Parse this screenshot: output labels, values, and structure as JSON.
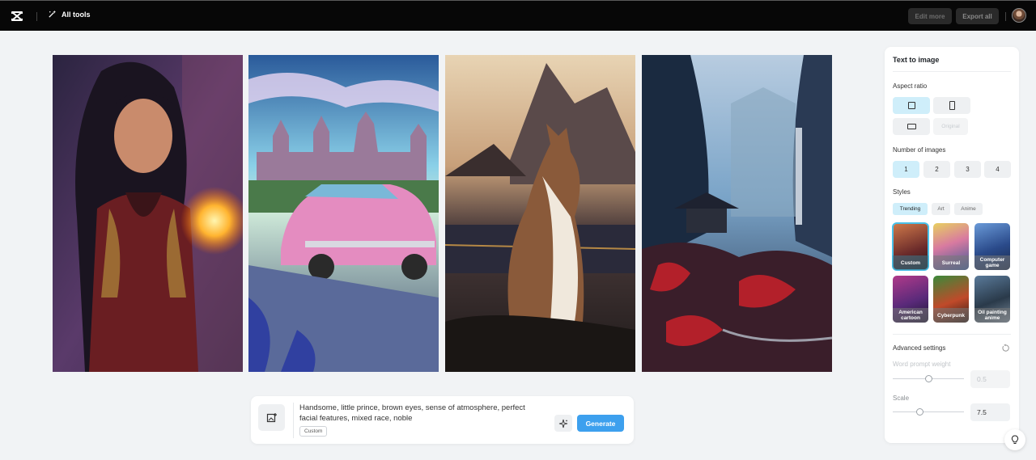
{
  "topbar": {
    "all_tools_label": "All tools",
    "edit_more_label": "Edit more",
    "export_all_label": "Export all"
  },
  "gallery": {
    "images": [
      {
        "subject": "warrior-woman",
        "palette": [
          "#3e2a55",
          "#7a2a30"
        ]
      },
      {
        "subject": "pink-car-castle",
        "palette": [
          "#5fb0d8",
          "#e58fc4"
        ]
      },
      {
        "subject": "cat-mountains",
        "palette": [
          "#d8b48a",
          "#3a2e2a"
        ]
      },
      {
        "subject": "valley-pagoda",
        "palette": [
          "#7aa4c8",
          "#b3202a"
        ]
      }
    ]
  },
  "prompt": {
    "text": "Handsome, little prince, brown eyes, sense of atmosphere, perfect facial features, mixed race, noble",
    "style_tag": "Custom",
    "generate_label": "Generate"
  },
  "panel": {
    "title": "Text to image",
    "aspect_ratio_label": "Aspect ratio",
    "aspect_original_label": "Original",
    "number_of_images_label": "Number of images",
    "number_options": [
      "1",
      "2",
      "3",
      "4"
    ],
    "number_selected": "1",
    "styles_label": "Styles",
    "style_tabs": [
      "Trending",
      "Art",
      "Anime"
    ],
    "style_cards": [
      "Custom",
      "Surreal",
      "Computer game",
      "American cartoon",
      "Cyberpunk",
      "Oil painting anime"
    ],
    "advanced_label": "Advanced settings",
    "word_prompt_weight_label": "Word prompt weight",
    "word_prompt_weight_value": "0.5",
    "scale_label": "Scale",
    "scale_value": "7.5"
  },
  "colors": {
    "accent": "#3da0ee",
    "selected_bg": "#cfeefa",
    "topbar_bg": "#070707"
  }
}
